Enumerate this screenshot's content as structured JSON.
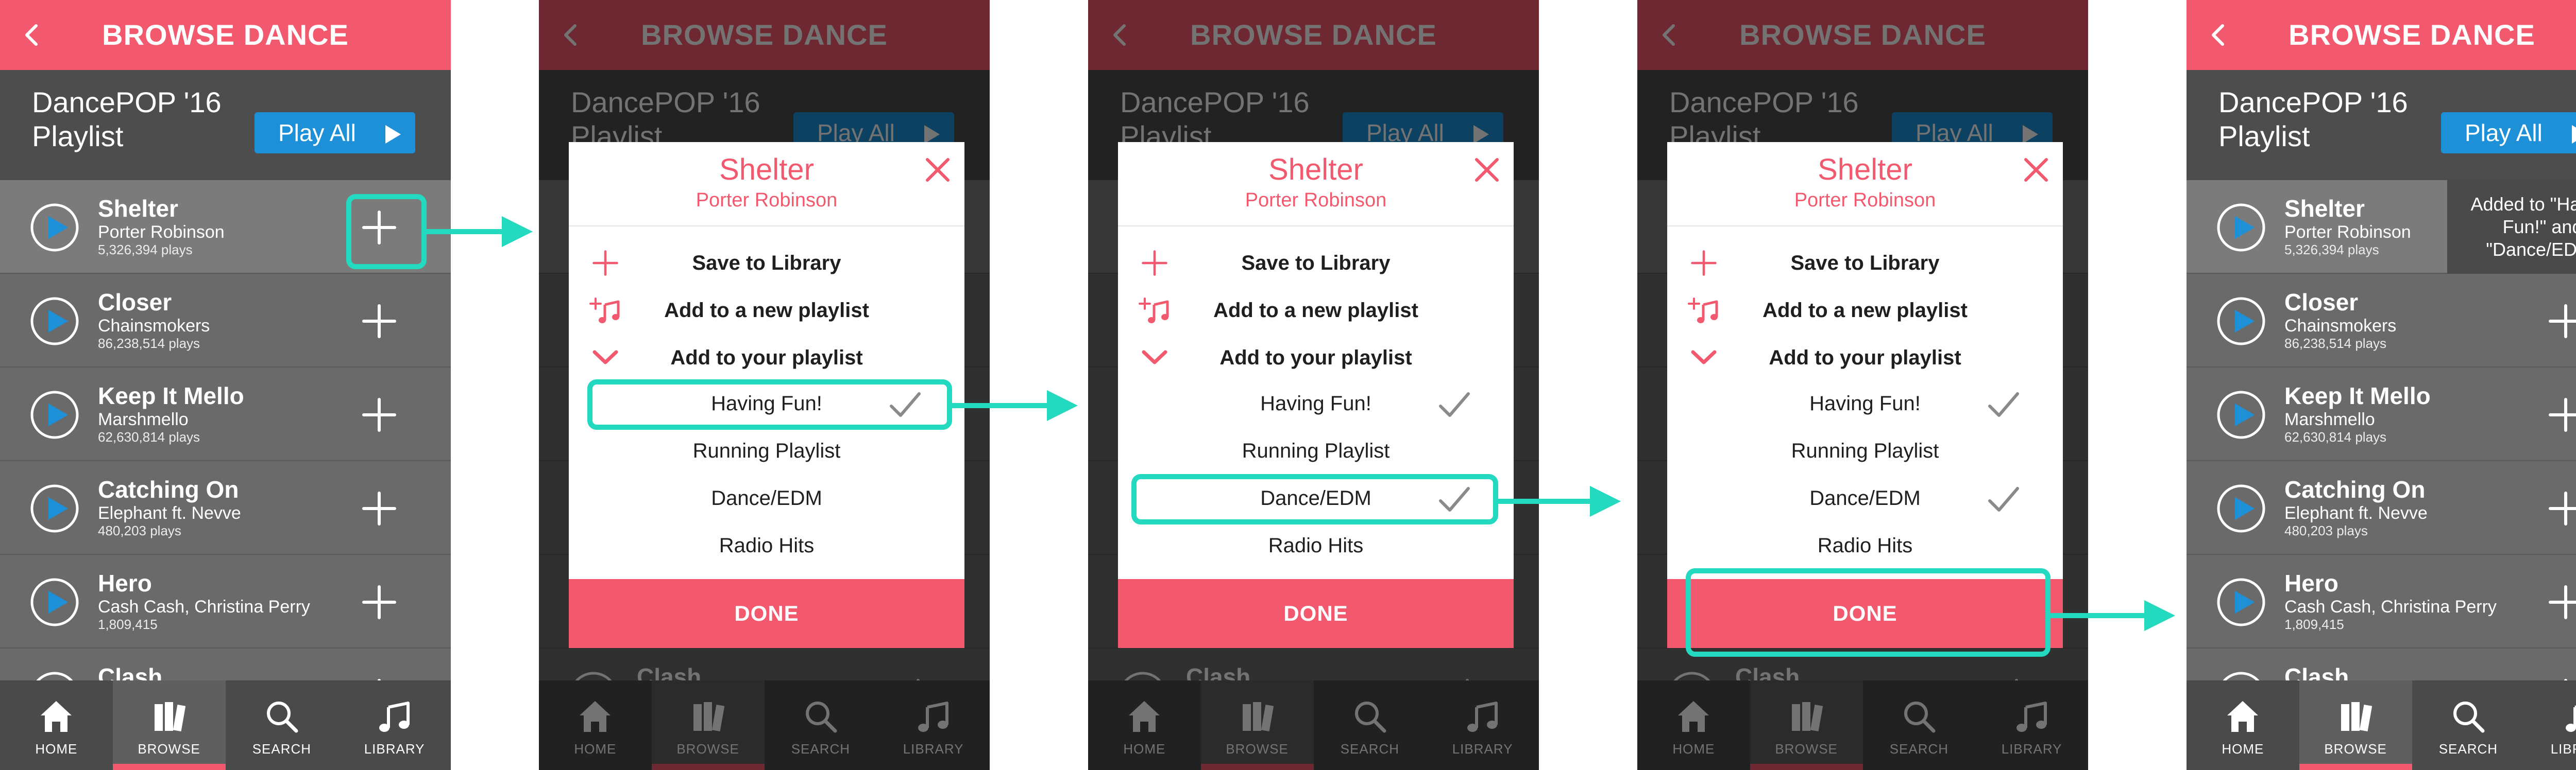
{
  "topbar": {
    "title": "BROWSE DANCE"
  },
  "playlist": {
    "title": "DancePOP '16 Playlist",
    "play_all": "Play All"
  },
  "songs": [
    {
      "title": "Shelter",
      "artist": "Porter Robinson",
      "plays": "5,326,394 plays"
    },
    {
      "title": "Closer",
      "artist": "Chainsmokers",
      "plays": "86,238,514 plays"
    },
    {
      "title": "Keep It Mello",
      "artist": "Marshmello",
      "plays": "62,630,814 plays"
    },
    {
      "title": "Catching On",
      "artist": "Elephant ft. Nevve",
      "plays": "480,203 plays"
    },
    {
      "title": "Hero",
      "artist": "Cash Cash, Christina Perry",
      "plays": "1,809,415"
    },
    {
      "title": "Clash",
      "artist": "",
      "plays": ""
    }
  ],
  "tabs": [
    {
      "label": "HOME",
      "icon": "home-icon"
    },
    {
      "label": "BROWSE",
      "icon": "browse-icon"
    },
    {
      "label": "SEARCH",
      "icon": "search-icon"
    },
    {
      "label": "LIBRARY",
      "icon": "music-note-icon"
    }
  ],
  "modal": {
    "title": "Shelter",
    "subtitle": "Porter Robinson",
    "options": [
      {
        "label": "Save to Library",
        "icon": "plus-icon"
      },
      {
        "label": "Add to a new playlist",
        "icon": "add-playlist-icon"
      },
      {
        "label": "Add to your playlist",
        "icon": "chevron-down-icon"
      }
    ],
    "playlists": [
      "Having Fun!",
      "Running Playlist",
      "Dance/EDM",
      "Radio Hits"
    ],
    "done": "DONE"
  },
  "toast": {
    "text": "Added to \"Having Fun!\" and \"Dance/EDM\""
  },
  "colors": {
    "accent": "#f2596e",
    "callout": "#23d9bf",
    "play_blue": "#1e90d8"
  },
  "flow": [
    {
      "step": 1,
      "selected_playlists": []
    },
    {
      "step": 2,
      "selected_playlists": [
        "Having Fun!"
      ]
    },
    {
      "step": 3,
      "selected_playlists": [
        "Having Fun!",
        "Dance/EDM"
      ]
    },
    {
      "step": 4,
      "selected_playlists": [
        "Having Fun!",
        "Dance/EDM"
      ]
    },
    {
      "step": 5,
      "selected_playlists": []
    }
  ]
}
